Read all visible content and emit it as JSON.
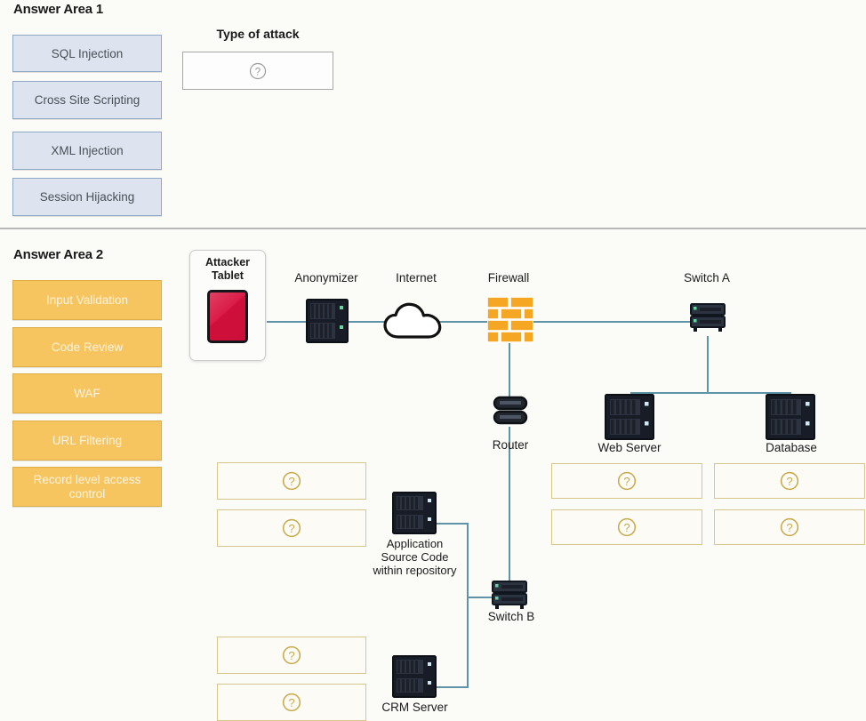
{
  "page": {
    "background": "#fbfbf8",
    "wire_color": "#5f94a8"
  },
  "answer_area_1": {
    "title": "Answer Area 1",
    "option_color": "#dde4ef",
    "option_border": "#8fa8c8",
    "options": [
      {
        "label": "SQL Injection"
      },
      {
        "label": "Cross Site Scripting"
      },
      {
        "label": "XML Injection"
      },
      {
        "label": "Session Hijacking"
      }
    ],
    "dropzone": {
      "label": "Type of attack",
      "placeholder_icon": "question-mark-icon",
      "value": ""
    }
  },
  "answer_area_2": {
    "title": "Answer Area 2",
    "option_color": "#f6c560",
    "option_border": "#e0ae47",
    "options": [
      {
        "label": "Input Validation"
      },
      {
        "label": "Code Review"
      },
      {
        "label": "WAF"
      },
      {
        "label": "URL Filtering"
      },
      {
        "label": "Record level access control"
      }
    ]
  },
  "diagram": {
    "nodes": [
      {
        "id": "attacker-tablet",
        "label": "Attacker\nTablet",
        "icon": "tablet-icon"
      },
      {
        "id": "anonymizer",
        "label": "Anonymizer",
        "icon": "server-icon"
      },
      {
        "id": "internet",
        "label": "Internet",
        "icon": "cloud-icon"
      },
      {
        "id": "firewall",
        "label": "Firewall",
        "icon": "firewall-brick-icon"
      },
      {
        "id": "switch-a",
        "label": "Switch A",
        "icon": "switch-icon"
      },
      {
        "id": "router",
        "label": "Router",
        "icon": "router-icon"
      },
      {
        "id": "web-server",
        "label": "Web Server",
        "icon": "server-icon"
      },
      {
        "id": "database",
        "label": "Database",
        "icon": "server-icon"
      },
      {
        "id": "app-source-code",
        "label": "Application\nSource Code\nwithin repository",
        "icon": "server-icon"
      },
      {
        "id": "switch-b",
        "label": "Switch B",
        "icon": "switch-icon"
      },
      {
        "id": "crm-server",
        "label": "CRM Server",
        "icon": "server-icon"
      }
    ],
    "node_labels": {
      "attacker_tablet_line1": "Attacker",
      "attacker_tablet_line2": "Tablet",
      "anonymizer": "Anonymizer",
      "internet": "Internet",
      "firewall": "Firewall",
      "switch_a": "Switch A",
      "router": "Router",
      "web_server": "Web Server",
      "database": "Database",
      "app_code_line1": "Application",
      "app_code_line2": "Source Code",
      "app_code_line3": "within repository",
      "switch_b": "Switch B",
      "crm_server": "CRM Server"
    },
    "dropzones": [
      {
        "id": "dz-left-1",
        "placeholder_icon": "question-mark-icon",
        "value": ""
      },
      {
        "id": "dz-left-2",
        "placeholder_icon": "question-mark-icon",
        "value": ""
      },
      {
        "id": "dz-web-1",
        "placeholder_icon": "question-mark-icon",
        "value": ""
      },
      {
        "id": "dz-db-1",
        "placeholder_icon": "question-mark-icon",
        "value": ""
      },
      {
        "id": "dz-web-2",
        "placeholder_icon": "question-mark-icon",
        "value": ""
      },
      {
        "id": "dz-db-2",
        "placeholder_icon": "question-mark-icon",
        "value": ""
      },
      {
        "id": "dz-left-3",
        "placeholder_icon": "question-mark-icon",
        "value": ""
      },
      {
        "id": "dz-left-4",
        "placeholder_icon": "question-mark-icon",
        "value": ""
      }
    ]
  }
}
